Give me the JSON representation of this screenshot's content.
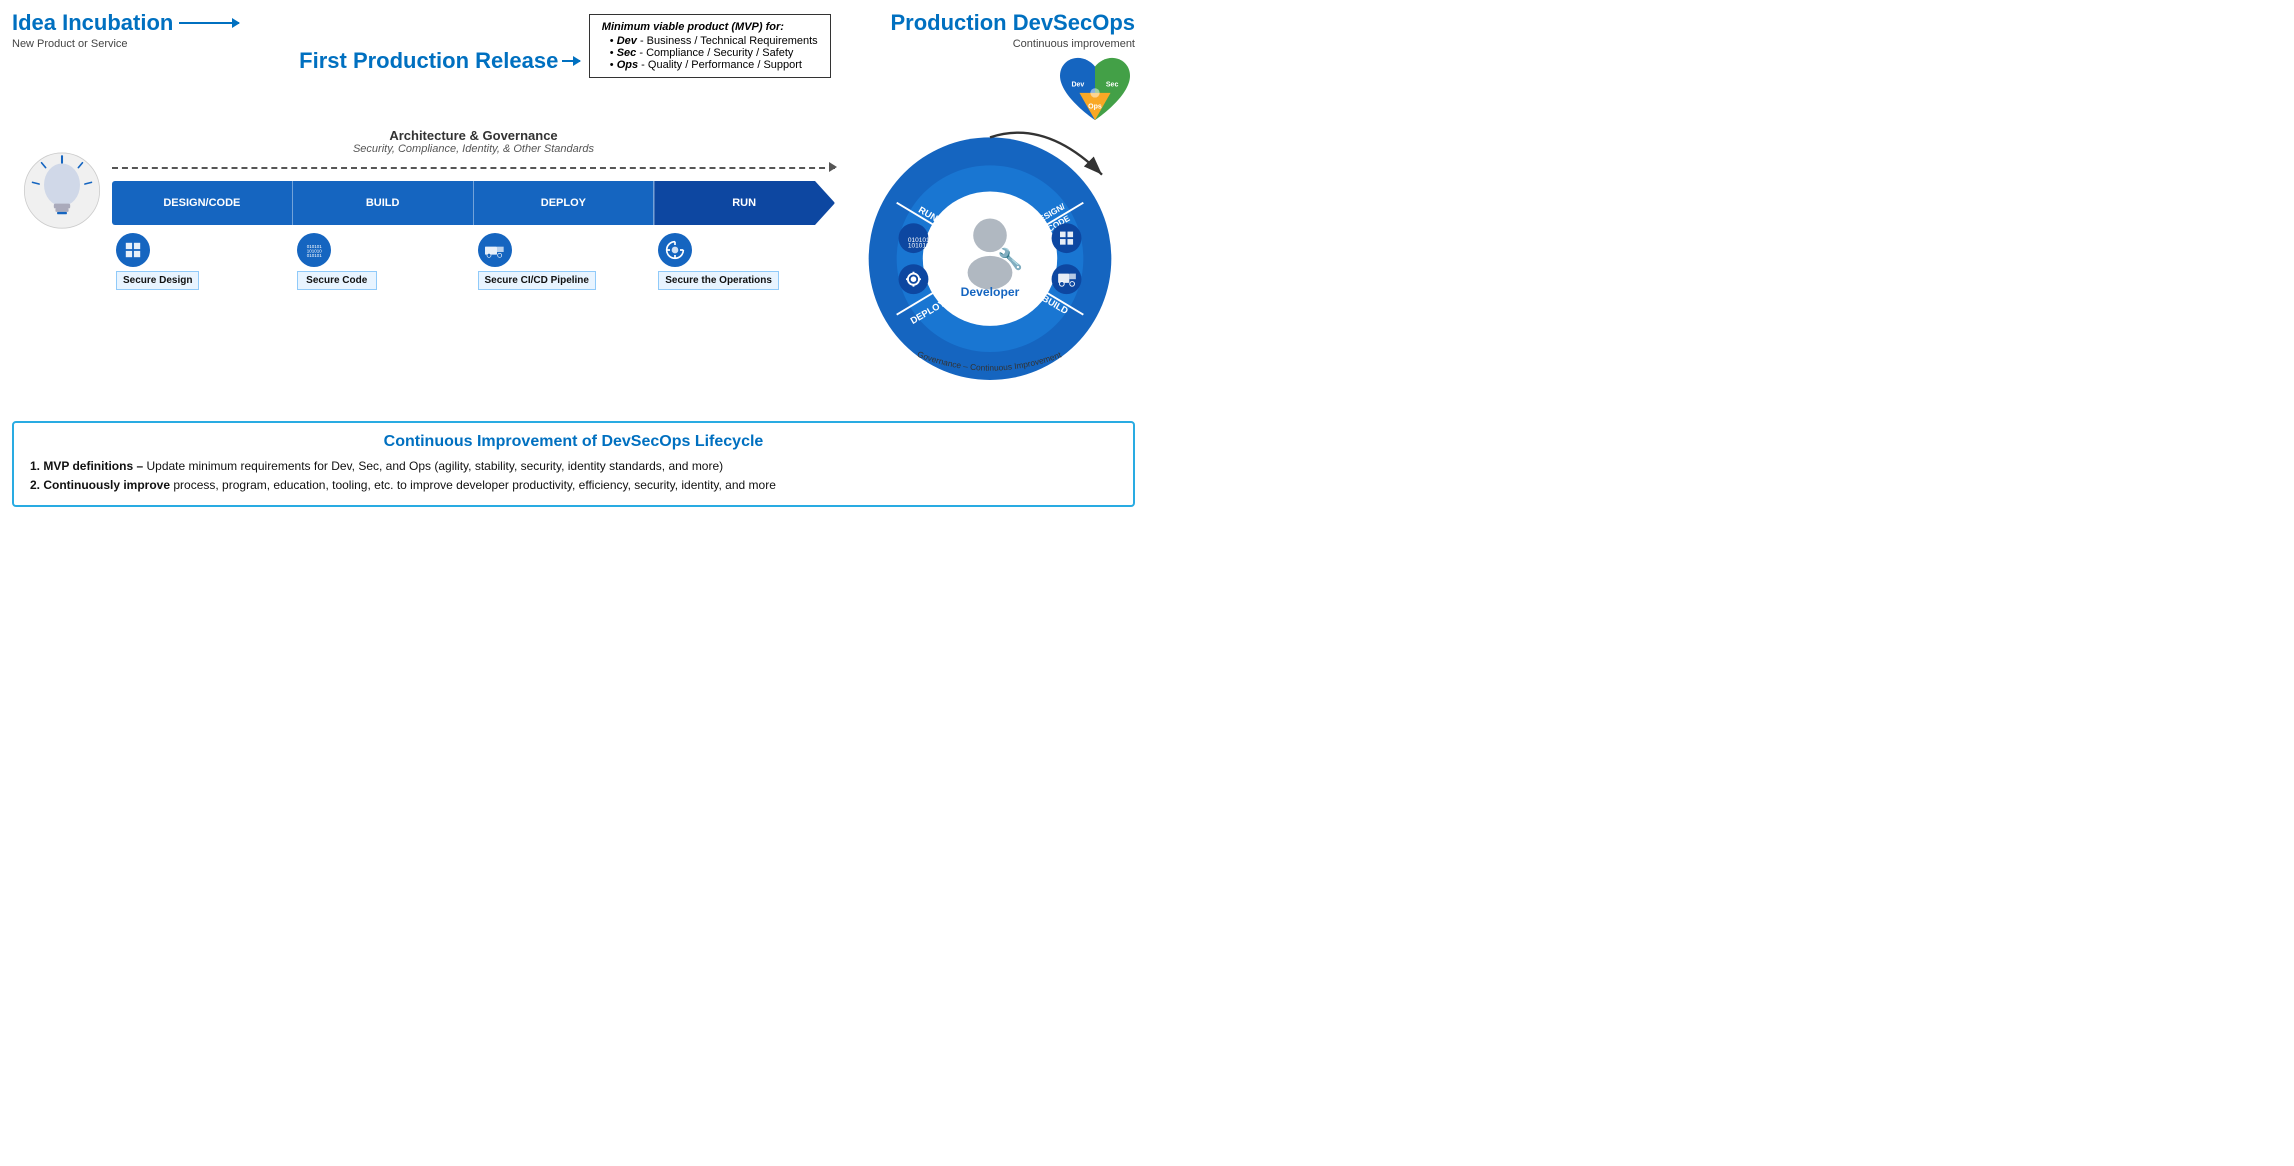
{
  "header": {
    "idea_incubation": "Idea Incubation",
    "idea_subtitle": "New Product or Service",
    "first_production": "First Production Release",
    "production_devsecops": "Production DevSecOps",
    "production_subtitle": "Continuous improvement"
  },
  "mvp": {
    "title": "Minimum viable product (MVP) for:",
    "items": [
      {
        "key": "Dev",
        "value": " - Business / Technical Requirements"
      },
      {
        "key": "Sec",
        "value": " - Compliance / Security / Safety"
      },
      {
        "key": "Ops",
        "value": " - Quality / Performance / Support"
      }
    ]
  },
  "pipeline": {
    "arch_title": "Architecture & Governance",
    "arch_subtitle": "Security, Compliance, Identity, & Other Standards",
    "segments": [
      {
        "label": "DESIGN/CODE"
      },
      {
        "label": "BUILD"
      },
      {
        "label": "DEPLOY"
      },
      {
        "label": "RUN"
      }
    ],
    "icons": [
      {
        "symbol": "⊞",
        "label": "Secure Design"
      },
      {
        "symbol": "01\n01\n01",
        "label": "Secure Code"
      },
      {
        "symbol": "🚛",
        "label": "Secure CI/CD Pipeline"
      },
      {
        "symbol": "⚙",
        "label": "Secure the Operations"
      }
    ]
  },
  "circular": {
    "segments": [
      "DESIGN/CODE",
      "BUILD",
      "DEPLOY",
      "RUN"
    ],
    "center_label": "Developer",
    "bottom_label": "Governance – Continuous Improvement"
  },
  "bottom": {
    "title": "Continuous Improvement of DevSecOps Lifecycle",
    "item1_bold": "MVP definitions –",
    "item1_text": " Update minimum requirements for Dev, Sec, and Ops (agility, stability, security, identity standards, and more)",
    "item2_bold": "Continuously improve",
    "item2_text": " process, program, education, tooling, etc. to improve developer productivity, efficiency, security, identity, and more"
  }
}
